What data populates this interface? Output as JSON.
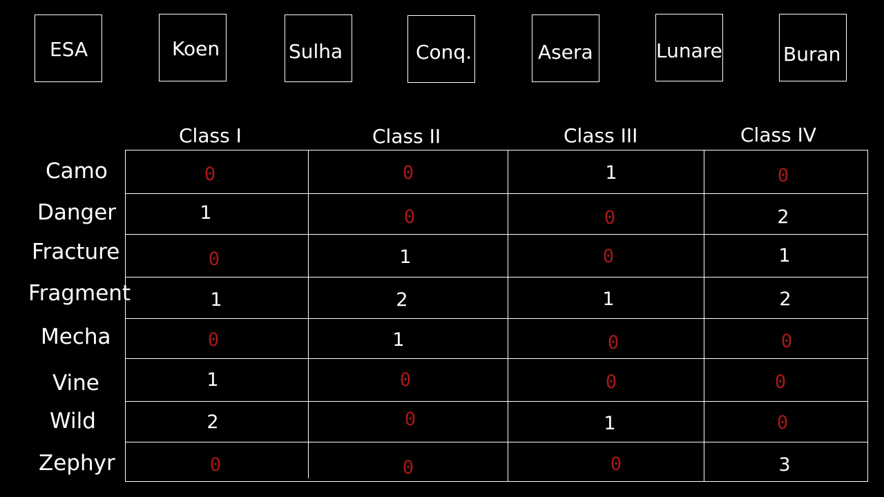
{
  "boxes": [
    "ESA",
    "Koen",
    "Sulha",
    "Conq.",
    "Asera",
    "Lunare",
    "Buran"
  ],
  "columns": [
    "Class I",
    "Class II",
    "Class III",
    "Class IV"
  ],
  "rows": [
    {
      "label": "Camo",
      "values": [
        "0",
        "0",
        "1",
        "0"
      ]
    },
    {
      "label": "Danger",
      "values": [
        "1",
        "0",
        "0",
        "2"
      ]
    },
    {
      "label": "Fracture",
      "values": [
        "0",
        "1",
        "0",
        "1"
      ]
    },
    {
      "label": "Fragment",
      "values": [
        "1",
        "2",
        "1",
        "2"
      ]
    },
    {
      "label": "Mecha",
      "values": [
        "0",
        "1",
        "0",
        "0"
      ]
    },
    {
      "label": "Vine",
      "values": [
        "1",
        "0",
        "0",
        "0"
      ]
    },
    {
      "label": "Wild",
      "values": [
        "2",
        "0",
        "1",
        "0"
      ]
    },
    {
      "label": "Zephyr",
      "values": [
        "0",
        "0",
        "0",
        "3"
      ]
    }
  ],
  "colors": {
    "background": "#000000",
    "text": "#ffffff",
    "zero": "#a81818"
  }
}
